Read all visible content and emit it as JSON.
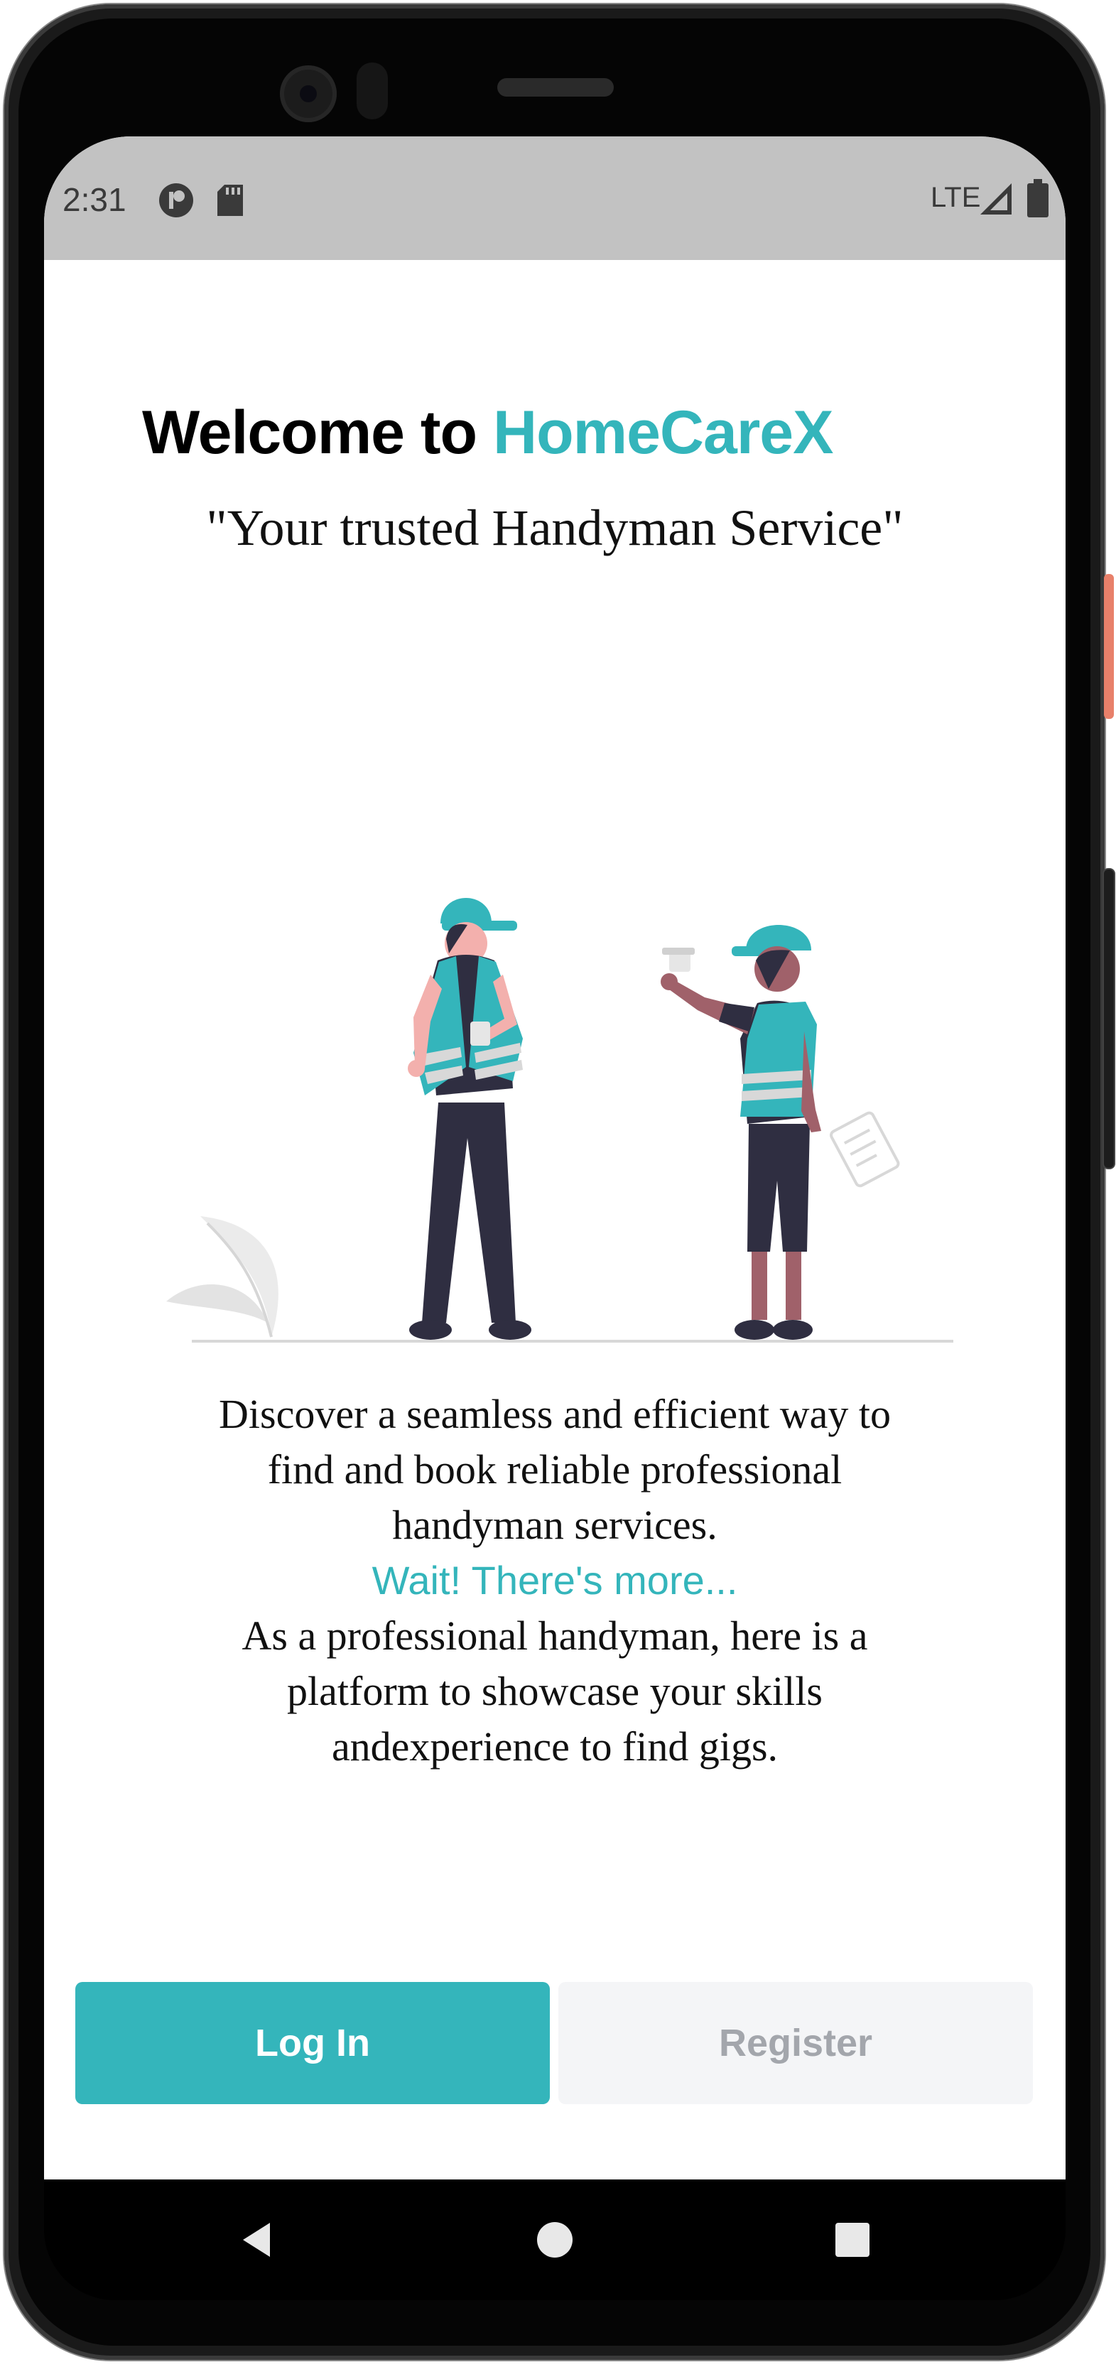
{
  "status_bar": {
    "time": "2:31",
    "network": "LTE",
    "icons": [
      "notification-icon",
      "sd-card-icon",
      "signal-icon",
      "battery-icon"
    ]
  },
  "header": {
    "welcome_prefix": "Welcome to ",
    "brand_name": "HomeCareX",
    "tagline": "\"Your trusted Handyman Service\""
  },
  "illustration": {
    "subject": "two construction workers with helmets and vests"
  },
  "description": {
    "line1": "Discover a seamless and efficient way to",
    "line2": "find  and book reliable professional",
    "line3": "handyman services.",
    "more_link": "Wait! There's more...",
    "line4": "As a professional handyman, here is a",
    "line5": "platform to showcase your skills",
    "line6": "andexperience to find gigs."
  },
  "actions": {
    "login_label": "Log In",
    "register_label": "Register"
  },
  "colors": {
    "accent": "#34b5bb",
    "status_bar_bg": "#c2c2c2",
    "register_bg": "#f4f5f7",
    "register_text": "#a3a6ac",
    "dark_figure": "#2f2e41"
  },
  "nav_bar": {
    "icons": [
      "back-icon",
      "home-icon",
      "recents-icon"
    ]
  }
}
